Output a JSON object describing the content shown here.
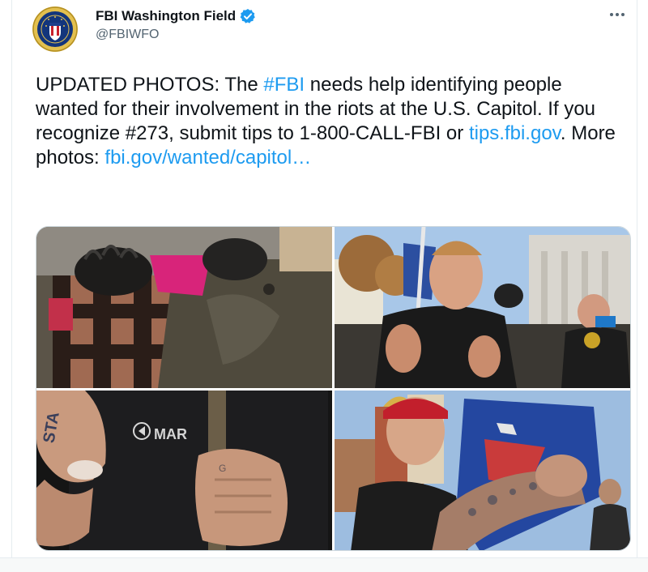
{
  "author": {
    "name": "FBI Washington Field",
    "handle": "@FBIWFO",
    "verified": true,
    "avatar_icon": "fbi-seal-icon"
  },
  "menu": {
    "more_icon": "more-horizontal-icon"
  },
  "tweet": {
    "text_part1": "UPDATED PHOTOS: The ",
    "hashtag": "#FBI",
    "text_part2": " needs help identifying people wanted for their involvement in the riots at the U.S. Capitol. If you recognize #273, submit tips to 1-800-CALL-FBI or ",
    "tips_link": "tips.fbi.gov",
    "text_part3": ". More photos: ",
    "more_link": "fbi.gov/wanted/capitol…"
  },
  "media": {
    "photos": [
      {
        "label": "gloved hands at plaid shirt"
      },
      {
        "label": "man holding flag pole in crowd"
      },
      {
        "label": "tattooed fingers close-up"
      },
      {
        "label": "man with red cap holding flag"
      }
    ],
    "photo3_shirt_text": "MAR",
    "photo3_knuckle_text": "STA"
  },
  "colors": {
    "link": "#1d9bf0",
    "text": "#0f1419",
    "muted": "#536471",
    "verified": "#1d9bf0"
  }
}
